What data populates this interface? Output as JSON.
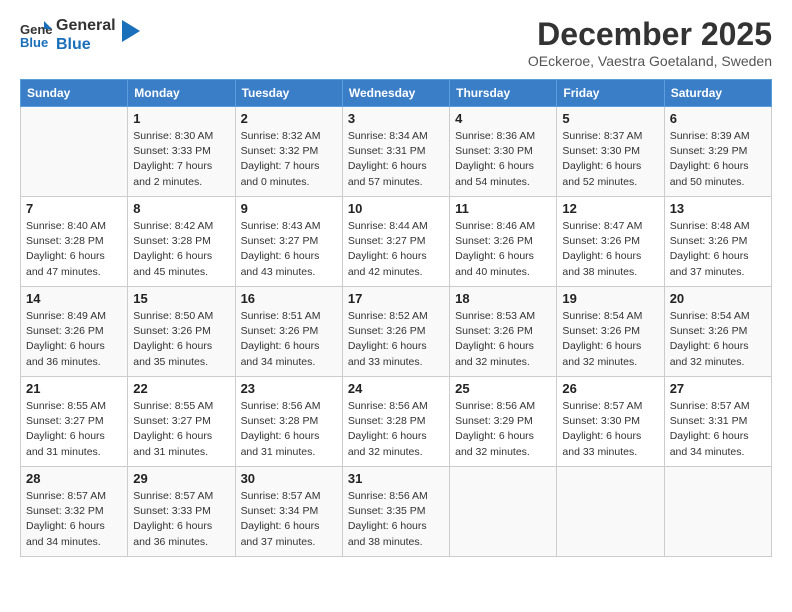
{
  "header": {
    "logo_general": "General",
    "logo_blue": "Blue",
    "month_title": "December 2025",
    "location": "OEckeroe, Vaestra Goetaland, Sweden"
  },
  "days_of_week": [
    "Sunday",
    "Monday",
    "Tuesday",
    "Wednesday",
    "Thursday",
    "Friday",
    "Saturday"
  ],
  "weeks": [
    [
      {
        "day": "",
        "info": ""
      },
      {
        "day": "1",
        "info": "Sunrise: 8:30 AM\nSunset: 3:33 PM\nDaylight: 7 hours\nand 2 minutes."
      },
      {
        "day": "2",
        "info": "Sunrise: 8:32 AM\nSunset: 3:32 PM\nDaylight: 7 hours\nand 0 minutes."
      },
      {
        "day": "3",
        "info": "Sunrise: 8:34 AM\nSunset: 3:31 PM\nDaylight: 6 hours\nand 57 minutes."
      },
      {
        "day": "4",
        "info": "Sunrise: 8:36 AM\nSunset: 3:30 PM\nDaylight: 6 hours\nand 54 minutes."
      },
      {
        "day": "5",
        "info": "Sunrise: 8:37 AM\nSunset: 3:30 PM\nDaylight: 6 hours\nand 52 minutes."
      },
      {
        "day": "6",
        "info": "Sunrise: 8:39 AM\nSunset: 3:29 PM\nDaylight: 6 hours\nand 50 minutes."
      }
    ],
    [
      {
        "day": "7",
        "info": "Sunrise: 8:40 AM\nSunset: 3:28 PM\nDaylight: 6 hours\nand 47 minutes."
      },
      {
        "day": "8",
        "info": "Sunrise: 8:42 AM\nSunset: 3:28 PM\nDaylight: 6 hours\nand 45 minutes."
      },
      {
        "day": "9",
        "info": "Sunrise: 8:43 AM\nSunset: 3:27 PM\nDaylight: 6 hours\nand 43 minutes."
      },
      {
        "day": "10",
        "info": "Sunrise: 8:44 AM\nSunset: 3:27 PM\nDaylight: 6 hours\nand 42 minutes."
      },
      {
        "day": "11",
        "info": "Sunrise: 8:46 AM\nSunset: 3:26 PM\nDaylight: 6 hours\nand 40 minutes."
      },
      {
        "day": "12",
        "info": "Sunrise: 8:47 AM\nSunset: 3:26 PM\nDaylight: 6 hours\nand 38 minutes."
      },
      {
        "day": "13",
        "info": "Sunrise: 8:48 AM\nSunset: 3:26 PM\nDaylight: 6 hours\nand 37 minutes."
      }
    ],
    [
      {
        "day": "14",
        "info": "Sunrise: 8:49 AM\nSunset: 3:26 PM\nDaylight: 6 hours\nand 36 minutes."
      },
      {
        "day": "15",
        "info": "Sunrise: 8:50 AM\nSunset: 3:26 PM\nDaylight: 6 hours\nand 35 minutes."
      },
      {
        "day": "16",
        "info": "Sunrise: 8:51 AM\nSunset: 3:26 PM\nDaylight: 6 hours\nand 34 minutes."
      },
      {
        "day": "17",
        "info": "Sunrise: 8:52 AM\nSunset: 3:26 PM\nDaylight: 6 hours\nand 33 minutes."
      },
      {
        "day": "18",
        "info": "Sunrise: 8:53 AM\nSunset: 3:26 PM\nDaylight: 6 hours\nand 32 minutes."
      },
      {
        "day": "19",
        "info": "Sunrise: 8:54 AM\nSunset: 3:26 PM\nDaylight: 6 hours\nand 32 minutes."
      },
      {
        "day": "20",
        "info": "Sunrise: 8:54 AM\nSunset: 3:26 PM\nDaylight: 6 hours\nand 32 minutes."
      }
    ],
    [
      {
        "day": "21",
        "info": "Sunrise: 8:55 AM\nSunset: 3:27 PM\nDaylight: 6 hours\nand 31 minutes."
      },
      {
        "day": "22",
        "info": "Sunrise: 8:55 AM\nSunset: 3:27 PM\nDaylight: 6 hours\nand 31 minutes."
      },
      {
        "day": "23",
        "info": "Sunrise: 8:56 AM\nSunset: 3:28 PM\nDaylight: 6 hours\nand 31 minutes."
      },
      {
        "day": "24",
        "info": "Sunrise: 8:56 AM\nSunset: 3:28 PM\nDaylight: 6 hours\nand 32 minutes."
      },
      {
        "day": "25",
        "info": "Sunrise: 8:56 AM\nSunset: 3:29 PM\nDaylight: 6 hours\nand 32 minutes."
      },
      {
        "day": "26",
        "info": "Sunrise: 8:57 AM\nSunset: 3:30 PM\nDaylight: 6 hours\nand 33 minutes."
      },
      {
        "day": "27",
        "info": "Sunrise: 8:57 AM\nSunset: 3:31 PM\nDaylight: 6 hours\nand 34 minutes."
      }
    ],
    [
      {
        "day": "28",
        "info": "Sunrise: 8:57 AM\nSunset: 3:32 PM\nDaylight: 6 hours\nand 34 minutes."
      },
      {
        "day": "29",
        "info": "Sunrise: 8:57 AM\nSunset: 3:33 PM\nDaylight: 6 hours\nand 36 minutes."
      },
      {
        "day": "30",
        "info": "Sunrise: 8:57 AM\nSunset: 3:34 PM\nDaylight: 6 hours\nand 37 minutes."
      },
      {
        "day": "31",
        "info": "Sunrise: 8:56 AM\nSunset: 3:35 PM\nDaylight: 6 hours\nand 38 minutes."
      },
      {
        "day": "",
        "info": ""
      },
      {
        "day": "",
        "info": ""
      },
      {
        "day": "",
        "info": ""
      }
    ]
  ]
}
